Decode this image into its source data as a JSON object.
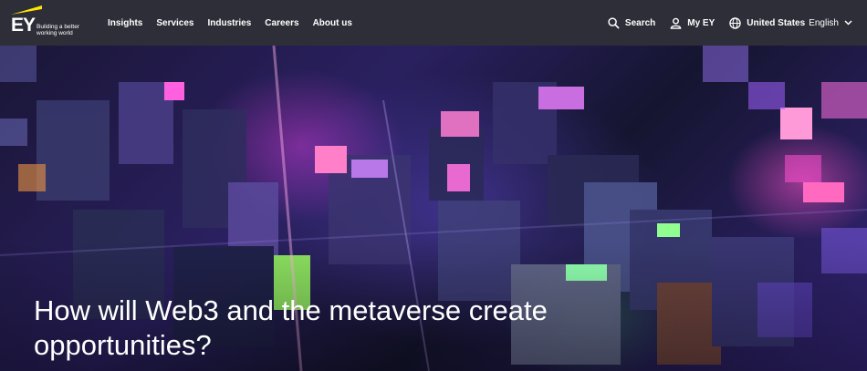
{
  "brand": {
    "logo_text": "EY",
    "tagline": "Building a better working world",
    "accent": "#ffe600"
  },
  "nav": {
    "items": [
      {
        "label": "Insights"
      },
      {
        "label": "Services"
      },
      {
        "label": "Industries"
      },
      {
        "label": "Careers"
      },
      {
        "label": "About us"
      }
    ]
  },
  "utility": {
    "search_label": "Search",
    "my_ey_label": "My EY",
    "country_label": "United States",
    "language_label": "English"
  },
  "hero": {
    "headline": "How will Web3 and the metaverse create opportunities?"
  },
  "colors": {
    "topbar_bg": "#2e2e38",
    "text": "#ffffff"
  }
}
